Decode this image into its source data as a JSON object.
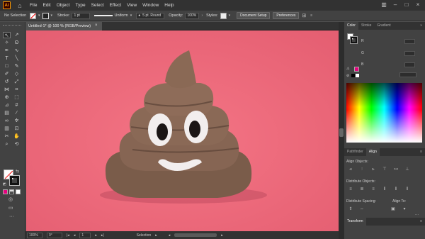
{
  "app": {
    "logo": "Ai"
  },
  "menu": [
    "File",
    "Edit",
    "Object",
    "Type",
    "Select",
    "Effect",
    "View",
    "Window",
    "Help"
  ],
  "control": {
    "selection_label": "No Selection",
    "stroke_label": "Stroke:",
    "stroke_value": "1 pt",
    "profile": "Uniform",
    "brush": "5 pt. Round",
    "opacity_label": "Opacity:",
    "opacity_value": "100%",
    "styles_label": "Styles:",
    "doc_setup": "Document Setup",
    "preferences": "Preferences"
  },
  "document": {
    "tab_title": "Untitled-1* @ 100 % (RGB/Preview)",
    "close": "×"
  },
  "status": {
    "zoom": "100%",
    "rotation": "0°",
    "page": "1",
    "tool": "Selection"
  },
  "panels": {
    "tabs": [
      "Color",
      "Stroke",
      "Gradient"
    ],
    "pathfinder_tabs": [
      "Pathfinder",
      "Align"
    ],
    "align_objects": "Align Objects:",
    "distribute_objects": "Distribute Objects:",
    "distribute_spacing": "Distribute Spacing:",
    "align_to": "Align To:",
    "transform": "Transform",
    "channel_r": "R",
    "channel_g": "G",
    "channel_b": "B"
  },
  "colors": {
    "canvas": "#ee6a7b",
    "accent": "#ff9a00",
    "hex_swatch": "#e6007e"
  }
}
